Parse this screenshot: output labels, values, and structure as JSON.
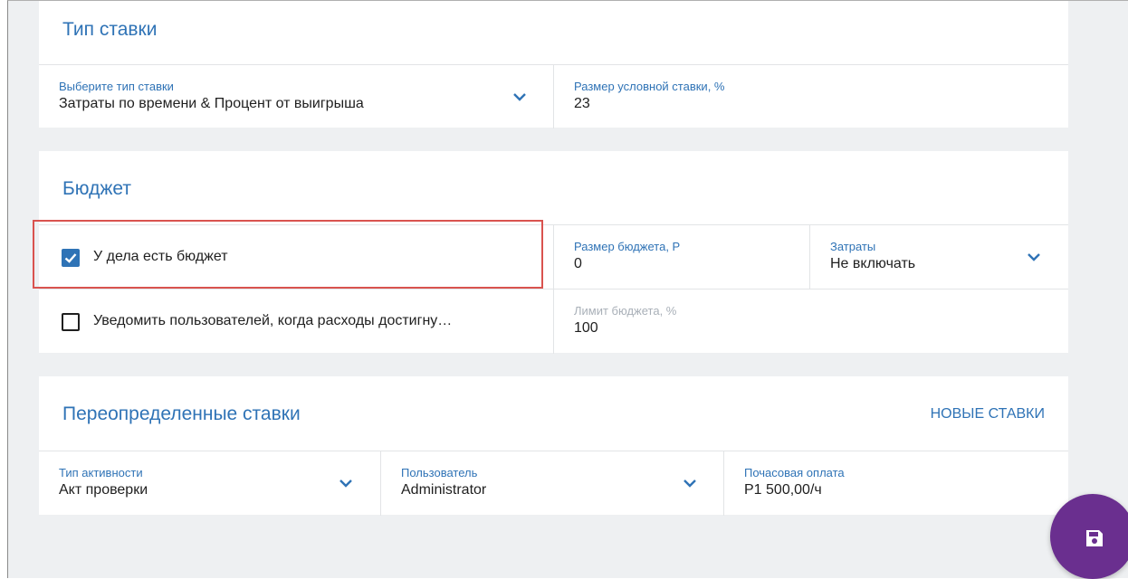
{
  "rate_type": {
    "title": "Тип ставки",
    "select_label": "Выберите тип ставки",
    "select_value": "Затраты по времени & Процент от выигрыша",
    "conditional_label": "Размер условной ставки, %",
    "conditional_value": "23"
  },
  "budget": {
    "title": "Бюджет",
    "has_budget_label": "У дела есть бюджет",
    "has_budget_checked": true,
    "budget_size_label": "Размер бюджета, Р",
    "budget_size_value": "0",
    "expenses_label": "Затраты",
    "expenses_value": "Не включать",
    "notify_label": "Уведомить пользователей, когда расходы достигну…",
    "notify_checked": false,
    "limit_label": "Лимит бюджета, %",
    "limit_value": "100"
  },
  "overrides": {
    "title": "Переопределенные ставки",
    "new_button": "НОВЫЕ СТАВКИ",
    "activity_label": "Тип активности",
    "activity_value": "Акт проверки",
    "user_label": "Пользователь",
    "user_value": "Administrator",
    "hourly_label": "Почасовая оплата",
    "hourly_value": "P1 500,00/ч"
  },
  "fab": {
    "icon": "save-icon"
  },
  "colors": {
    "accent": "#2f73b6",
    "highlight": "#d9534f",
    "fab": "#6a2f8f",
    "background": "#eef0f2"
  }
}
